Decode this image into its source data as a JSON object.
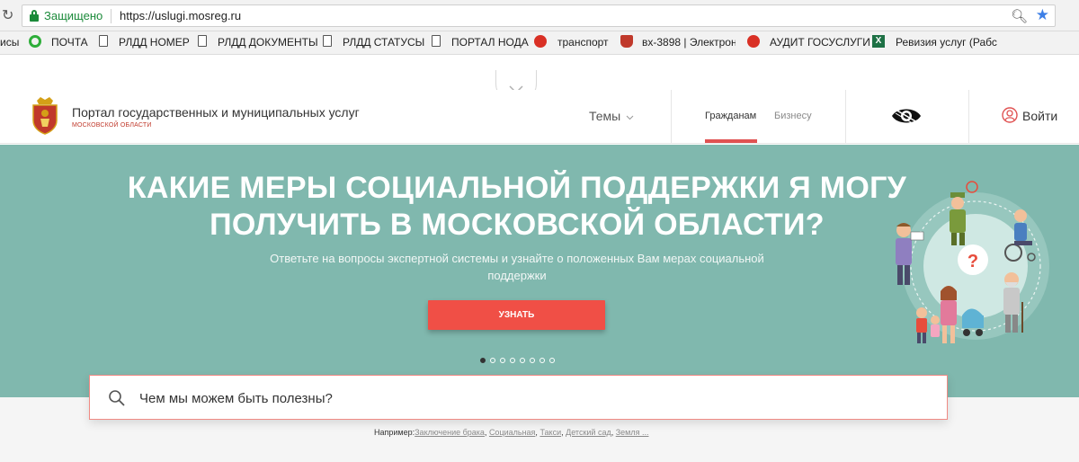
{
  "browser": {
    "secure_label": "Защищено",
    "url": "https://uslugi.mosreg.ru",
    "bookmarks": [
      {
        "label": "исы",
        "icon": "none"
      },
      {
        "label": "ПОЧТА",
        "icon": "ring-icon"
      },
      {
        "label": "РЛДД НОМЕР",
        "icon": "page-icon"
      },
      {
        "label": "РЛДД ДОКУМЕНТЫ",
        "icon": "page-icon"
      },
      {
        "label": "РЛДД СТАТУСЫ",
        "icon": "page-icon"
      },
      {
        "label": "ПОРТАЛ НОДА",
        "icon": "page-icon"
      },
      {
        "label": "транспорт",
        "icon": "circle-icon"
      },
      {
        "label": "вх-3898 | Электрон",
        "icon": "crest-icon"
      },
      {
        "label": "АУДИТ ГОСУСЛУГИ",
        "icon": "circle-icon"
      },
      {
        "label": "Ревизия услуг (Рабс",
        "icon": "excel-icon"
      }
    ]
  },
  "header": {
    "portal_title": "Портал государственных и муниципальных услуг",
    "portal_subtitle": "МОСКОВСКОЙ ОБЛАСТИ",
    "themes_label": "Темы",
    "citizens_label": "Гражданам",
    "business_label": "Бизнесу",
    "login_label": "Войти"
  },
  "hero": {
    "title": "КАКИЕ МЕРЫ СОЦИАЛЬНОЙ ПОДДЕРЖКИ Я МОГУ ПОЛУЧИТЬ В МОСКОВСКОЙ ОБЛАСТИ?",
    "subtitle": "Ответьте на вопросы экспертной системы и узнайте о положенных Вам мерах социальной поддержки",
    "button_label": "УЗНАТЬ",
    "slides_count": 8,
    "active_slide": 1
  },
  "search": {
    "placeholder": "Чем мы можем быть полезны?",
    "examples_prefix": "Например:",
    "examples": [
      "Заключение брака",
      "Социальная",
      "Такси",
      "Детский сад",
      "Земля ..."
    ]
  },
  "colors": {
    "hero_bg": "#80b8ae",
    "accent_red": "#f04f46",
    "secure_green": "#1b8a3a"
  }
}
